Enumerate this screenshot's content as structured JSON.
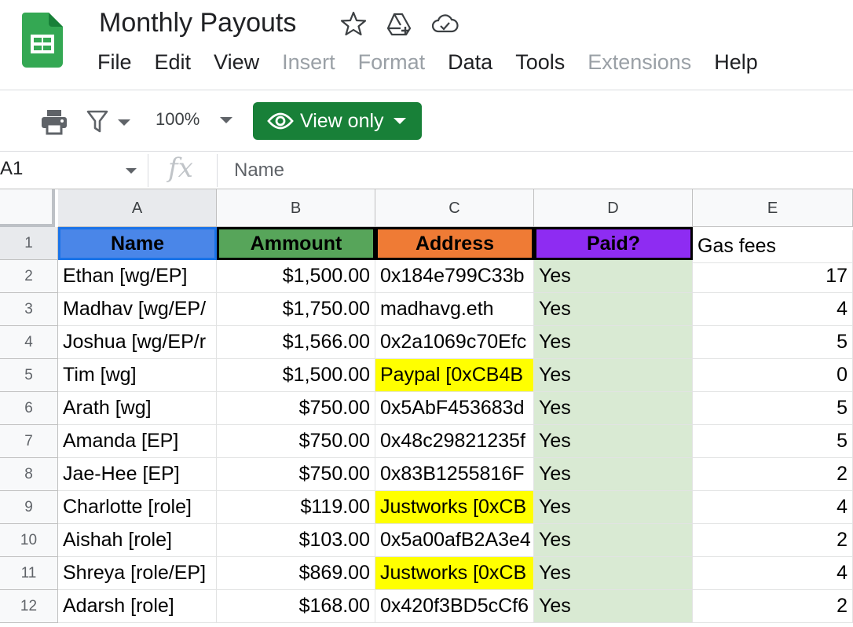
{
  "app": {
    "title": "Monthly Payouts",
    "icons": [
      "sheets-logo-icon",
      "star-icon",
      "move-to-drive-icon",
      "cloud-saved-icon"
    ]
  },
  "menu": [
    {
      "label": "File",
      "disabled": false
    },
    {
      "label": "Edit",
      "disabled": false
    },
    {
      "label": "View",
      "disabled": false
    },
    {
      "label": "Insert",
      "disabled": true
    },
    {
      "label": "Format",
      "disabled": true
    },
    {
      "label": "Data",
      "disabled": false
    },
    {
      "label": "Tools",
      "disabled": false
    },
    {
      "label": "Extensions",
      "disabled": true
    },
    {
      "label": "Help",
      "disabled": false
    }
  ],
  "toolbar": {
    "zoom": "100%",
    "view_mode_label": "View only",
    "accent": "#188038"
  },
  "formula_bar": {
    "cell_ref": "A1",
    "fx": "fx",
    "value": "Name"
  },
  "sheet": {
    "columns": [
      "A",
      "B",
      "C",
      "D",
      "E"
    ],
    "rows": [
      "1",
      "2",
      "3",
      "4",
      "5",
      "6",
      "7",
      "8",
      "9",
      "10",
      "11",
      "12"
    ],
    "header_row": {
      "name": "Name",
      "amount": "Ammount",
      "address": "Address",
      "paid": "Paid?",
      "gas": "Gas fees"
    },
    "header_colors": {
      "name": "#4a86e8",
      "amount": "#57a55a",
      "address": "#ef7b35",
      "paid": "#8e2cf2"
    },
    "data": [
      {
        "name": "Ethan [wg/EP]",
        "amount": "$1,500.00",
        "address": "0x184e799C33b",
        "address_highlight": false,
        "paid": "Yes",
        "gas": "17"
      },
      {
        "name": "Madhav [wg/EP/",
        "amount": "$1,750.00",
        "address": "madhavg.eth",
        "address_highlight": false,
        "paid": "Yes",
        "gas": "4"
      },
      {
        "name": "Joshua [wg/EP/r",
        "amount": "$1,566.00",
        "address": "0x2a1069c70Efc",
        "address_highlight": false,
        "paid": "Yes",
        "gas": "5"
      },
      {
        "name": "Tim [wg]",
        "amount": "$1,500.00",
        "address": "Paypal [0xCB4B",
        "address_highlight": true,
        "paid": "Yes",
        "gas": "0"
      },
      {
        "name": "Arath [wg]",
        "amount": "$750.00",
        "address": "0x5AbF453683d",
        "address_highlight": false,
        "paid": "Yes",
        "gas": "5"
      },
      {
        "name": "Amanda [EP]",
        "amount": "$750.00",
        "address": "0x48c29821235f",
        "address_highlight": false,
        "paid": "Yes",
        "gas": "5"
      },
      {
        "name": "Jae-Hee [EP]",
        "amount": "$750.00",
        "address": "0x83B1255816F",
        "address_highlight": false,
        "paid": "Yes",
        "gas": "2"
      },
      {
        "name": "Charlotte [role]",
        "amount": "$119.00",
        "address": "Justworks [0xCB",
        "address_highlight": true,
        "paid": "Yes",
        "gas": "4"
      },
      {
        "name": "Aishah [role]",
        "amount": "$103.00",
        "address": "0x5a00afB2A3e4",
        "address_highlight": false,
        "paid": "Yes",
        "gas": "2"
      },
      {
        "name": "Shreya [role/EP]",
        "amount": "$869.00",
        "address": "Justworks [0xCB",
        "address_highlight": true,
        "paid": "Yes",
        "gas": "4"
      },
      {
        "name": "Adarsh [role]",
        "amount": "$168.00",
        "address": "0x420f3BD5cCf6",
        "address_highlight": false,
        "paid": "Yes",
        "gas": "2"
      }
    ]
  }
}
